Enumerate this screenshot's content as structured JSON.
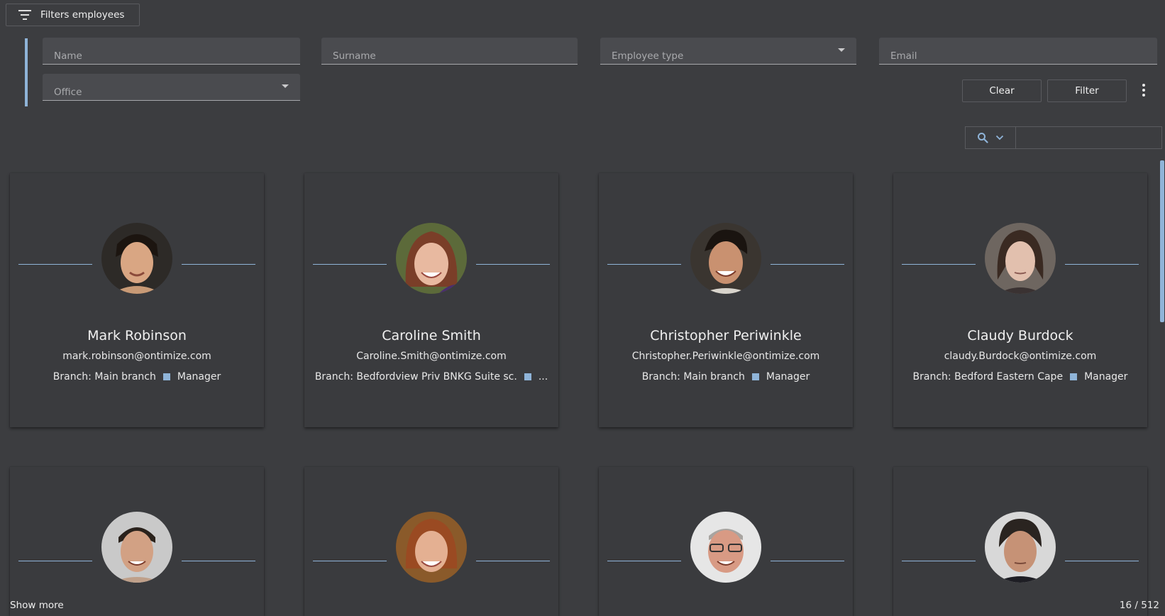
{
  "filter_toggle": {
    "label": "Filters employees",
    "icon": "filter-list-icon"
  },
  "fields": {
    "name": {
      "placeholder": "Name"
    },
    "surname": {
      "placeholder": "Surname"
    },
    "employee_type": {
      "placeholder": "Employee type"
    },
    "email": {
      "placeholder": "Email"
    },
    "office": {
      "placeholder": "Office"
    }
  },
  "buttons": {
    "clear": "Clear",
    "filter": "Filter"
  },
  "search": {
    "icon": "search-icon",
    "dropdown_icon": "chevron-down-icon",
    "value": ""
  },
  "accent_color": "#8fb4d8",
  "cards": [
    {
      "name": "Mark Robinson",
      "email": "mark.robinson@ontimize.com",
      "branch": "Branch: Main branch",
      "role": "Manager"
    },
    {
      "name": "Caroline Smith",
      "email": "Caroline.Smith@ontimize.com",
      "branch": "Branch: Bedfordview Priv BNKG Suite sc.",
      "role": "..."
    },
    {
      "name": "Christopher Periwinkle",
      "email": "Christopher.Periwinkle@ontimize.com",
      "branch": "Branch: Main branch",
      "role": "Manager"
    },
    {
      "name": "Claudy Burdock",
      "email": "claudy.Burdock@ontimize.com",
      "branch": "Branch: Bedford Eastern Cape",
      "role": "Manager"
    }
  ],
  "footer": {
    "show_more": "Show more",
    "count": "16 / 512"
  }
}
